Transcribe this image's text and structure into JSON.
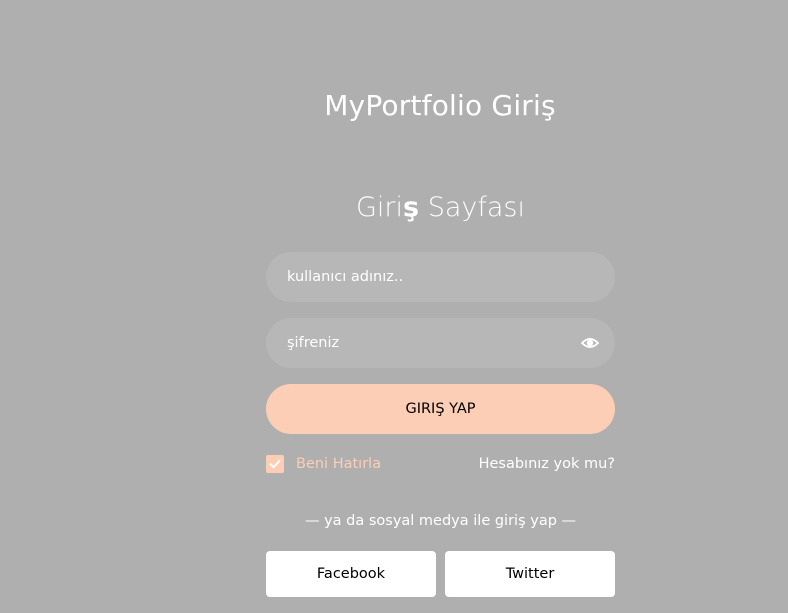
{
  "brand": {
    "title": "MyPortfolio Giriş"
  },
  "form": {
    "heading_prefix": "Giri",
    "heading_bold": "ş",
    "heading_suffix": " Sayfası",
    "username_placeholder": "kullanıcı adınız..",
    "password_placeholder": "şifreniz",
    "submit_label": "GIRIŞ YAP",
    "remember_label": "Beni Hatırla",
    "remember_checked": true,
    "signup_link": "Hesabınız yok mu?",
    "social_text": "— ya da sosyal medya ile giriş yap —",
    "facebook_label": "Facebook",
    "twitter_label": "Twitter"
  },
  "colors": {
    "background": "#afafaf",
    "accent": "#fbceb5",
    "text": "#ffffff"
  },
  "icons": {
    "password_toggle": "eye-icon",
    "checkbox": "check-icon"
  }
}
